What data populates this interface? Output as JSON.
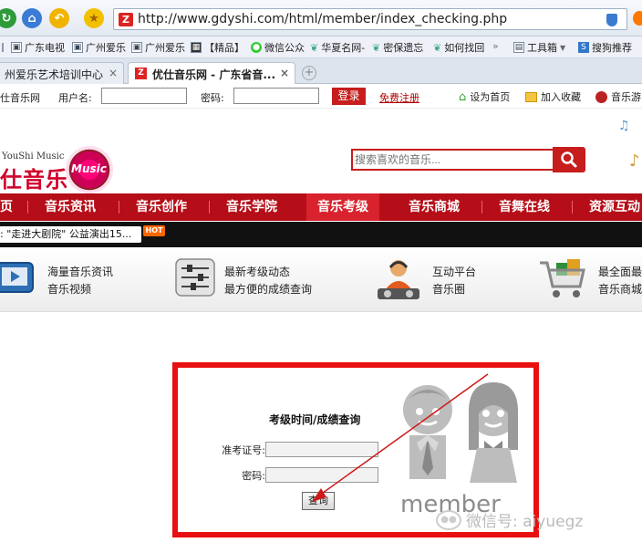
{
  "browser": {
    "url": "http://www.gdyshi.com/html/member/index_checking.php",
    "favorites": [
      "广东电视",
      "广州爱乐",
      "广州爱乐",
      "【精品】",
      "微信公众",
      "华夏名网-",
      "密保遗忘",
      "如何找回",
      "工具箱",
      "搜狗推荐"
    ],
    "tabs": [
      {
        "title": "州爱乐艺术培训中心"
      },
      {
        "title": "优仕音乐网 - 广东省音..."
      }
    ]
  },
  "topbar": {
    "site_name": "仕音乐网",
    "username_label": "用户名:",
    "username_value": "",
    "password_label": "密码:",
    "password_value": "",
    "login_label": "登录",
    "register_label": "免费注册",
    "set_home_label": "设为首页",
    "favorite_label": "加入收藏",
    "music_label": "音乐游"
  },
  "header": {
    "logo_en": "YouShi Music",
    "logo_cn": "仕音乐",
    "logo_badge": "Music",
    "search_placeholder": "搜索喜欢的音乐..."
  },
  "nav": {
    "items": [
      "页",
      "音乐资讯",
      "音乐创作",
      "音乐学院",
      "音乐考级",
      "音乐商城",
      "音舞在线",
      "资源互动"
    ],
    "active_index": 4
  },
  "ticker": {
    "text": ": \"走进大剧院\" 公益演出15...",
    "badge": "HOT"
  },
  "features": [
    {
      "line1": "海量音乐资讯",
      "line2": "音乐视频"
    },
    {
      "line1": "最新考级动态",
      "line2": "最方便的成绩查询"
    },
    {
      "line1": "互动平台",
      "line2": "音乐圈"
    },
    {
      "line1": "最全面最",
      "line2": "音乐商城"
    }
  ],
  "form": {
    "title": "考级时间/成绩查询",
    "ticket_label": "准考证号:",
    "ticket_value": "",
    "password_label": "密码:",
    "password_value": "",
    "submit_label": "查询"
  },
  "member_text": "member",
  "watermark": "微信号: aiyuegz",
  "colors": {
    "brand_red": "#b50e18",
    "panel_border": "#e81010"
  }
}
